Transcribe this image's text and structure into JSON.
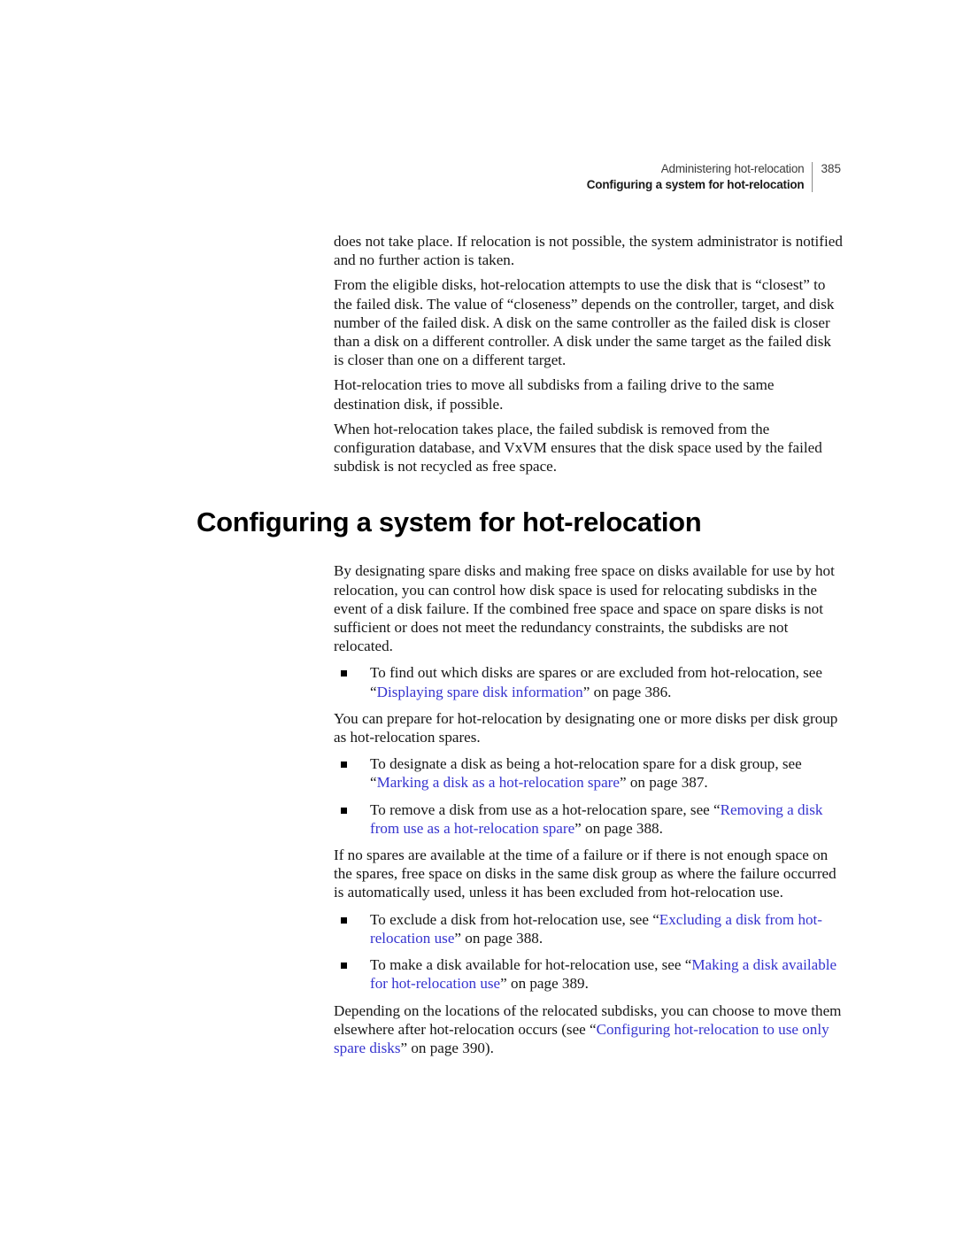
{
  "header": {
    "chapter": "Administering hot-relocation",
    "section": "Configuring a system for hot-relocation",
    "page_number": "385"
  },
  "section_title": "Configuring a system for hot-relocation",
  "link_color": "#3634cf",
  "paragraphs": {
    "p1": "does not take place. If relocation is not possible, the system administrator is notified and no further action is taken.",
    "p2": "From the eligible disks, hot-relocation attempts to use the disk that is “closest” to the failed disk. The value of “closeness” depends on the controller, target, and disk number of the failed disk. A disk on the same controller as the failed disk is closer than a disk on a different controller. A disk under the same target as the failed disk is closer than one on a different target.",
    "p3": "Hot-relocation tries to move all subdisks from a failing drive to the same destination disk, if possible.",
    "p4": "When hot-relocation takes place, the failed subdisk is removed from the configuration database, and VxVM ensures that the disk space used by the failed subdisk is not recycled as free space.",
    "p5": "By designating spare disks and making free space on disks available for use by hot relocation, you can control how disk space is used for relocating subdisks in the event of a disk failure. If the combined free space and space on spare disks is not sufficient or does not meet the redundancy constraints, the subdisks are not relocated.",
    "p6": "You can prepare for hot-relocation by designating one or more disks per disk group as hot-relocation spares.",
    "p7": "If no spares are available at the time of a failure or if there is not enough space on the spares, free space on disks in the same disk group as where the failure occurred is automatically used, unless it has been excluded from hot-relocation use."
  },
  "bullets": {
    "b1": {
      "lead": "To find out which disks are spares or are excluded from hot-relocation, see “",
      "link": "Displaying spare disk information",
      "tail": "” on page 386."
    },
    "b2": {
      "lead": "To designate a disk as being a hot-relocation spare for a disk group, see “",
      "link": "Marking a disk as a hot-relocation spare",
      "tail": "” on page 387."
    },
    "b3": {
      "lead": "To remove a disk from use as a hot-relocation spare, see “",
      "link": "Removing a disk from use as a hot-relocation spare",
      "tail": "” on page 388."
    },
    "b4": {
      "lead": "To exclude a disk from hot-relocation use, see “",
      "link": "Excluding a disk from hot-relocation use",
      "tail": "” on page 388."
    },
    "b5": {
      "lead": "To make a disk available for hot-relocation use, see “",
      "link": "Making a disk available for hot-relocation use",
      "tail": "” on page 389."
    }
  },
  "closing": {
    "lead": "Depending on the locations of the relocated subdisks, you can choose to move them elsewhere after hot-relocation occurs (see “",
    "link": "Configuring hot-relocation to use only spare disks",
    "tail": "” on page 390)."
  }
}
